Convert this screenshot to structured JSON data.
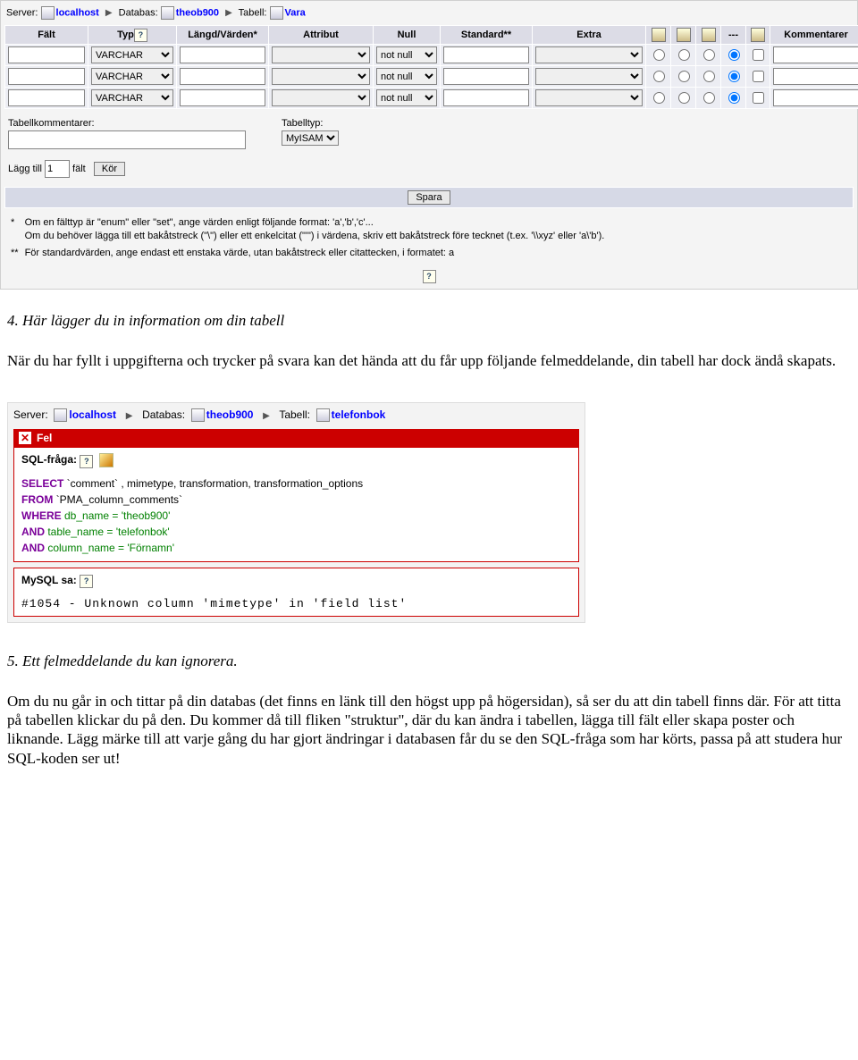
{
  "breadcrumb1": {
    "server_label": "Server:",
    "server": "localhost",
    "db_label": "Databas:",
    "db": "theob900",
    "table_label": "Tabell:",
    "table": "Vara"
  },
  "grid_headers": {
    "field": "Fält",
    "type": "Typ",
    "length": "Längd/Värden*",
    "attr": "Attribut",
    "null": "Null",
    "default": "Standard**",
    "extra": "Extra",
    "dash": "---",
    "comments": "Kommentarer"
  },
  "row_defaults": {
    "type_option": "VARCHAR",
    "null_option": "not null"
  },
  "comments_block": {
    "label": "Tabellkommentarer:"
  },
  "tabletype_block": {
    "label": "Tabelltyp:",
    "option": "MyISAM"
  },
  "addfields": {
    "prefix": "Lägg till",
    "value": "1",
    "suffix": "fält",
    "run": "Kör"
  },
  "save_button": "Spara",
  "footnotes": {
    "star1_key": "*",
    "star1_line1": "Om en fälttyp är \"enum\" eller \"set\", ange värden enligt följande format: 'a','b','c'...",
    "star1_line2": "Om du behöver lägga till ett bakåtstreck (\"\\\") eller ett enkelcitat (\"'\") i värdena, skriv ett bakåtstreck före tecknet (t.ex. '\\\\xyz' eller 'a\\'b').",
    "star2_key": "**",
    "star2": "För standardvärden, ange endast ett enstaka värde, utan bakåtstreck eller citattecken, i formatet: a"
  },
  "caption4": "4. Här lägger du in information om din tabell",
  "para1": "När du har fyllt i uppgifterna och trycker på svara kan det hända att du får upp följande felmeddelande, din tabell har dock ändå skapats.",
  "breadcrumb2": {
    "server_label": "Server:",
    "server": "localhost",
    "db_label": "Databas:",
    "db": "theob900",
    "table_label": "Tabell:",
    "table": "telefonbok"
  },
  "error": {
    "title": "Fel",
    "sql_header": "SQL-fråga:",
    "sql_select_kw": "SELECT",
    "sql_select_rest": " `comment` , mimetype, transformation, transformation_options",
    "sql_from_kw": "FROM",
    "sql_from_rest": " `PMA_column_comments`",
    "sql_where_kw": "WHERE",
    "sql_where_rest": " db_name = 'theob900'",
    "sql_and1_kw": "AND",
    "sql_and1_rest": " table_name = 'telefonbok'",
    "sql_and2_kw": "AND",
    "sql_and2_rest": " column_name = 'Förnamn'",
    "mysql_header": "MySQL sa:",
    "mysql_msg": "#1054 - Unknown column 'mimetype' in 'field list'"
  },
  "caption5": "5. Ett felmeddelande du kan ignorera.",
  "para2": "Om du nu går in och tittar på din databas (det finns en länk till den högst upp på högersidan), så ser du att din tabell finns där. För att titta på tabellen klickar du på den. Du kommer då till fliken \"struktur\", där du kan ändra i tabellen, lägga till fält eller skapa poster och liknande. Lägg märke till att varje gång du har gjort ändringar i databasen får du se den SQL-fråga som har körts, passa på att studera hur SQL-koden ser ut!"
}
